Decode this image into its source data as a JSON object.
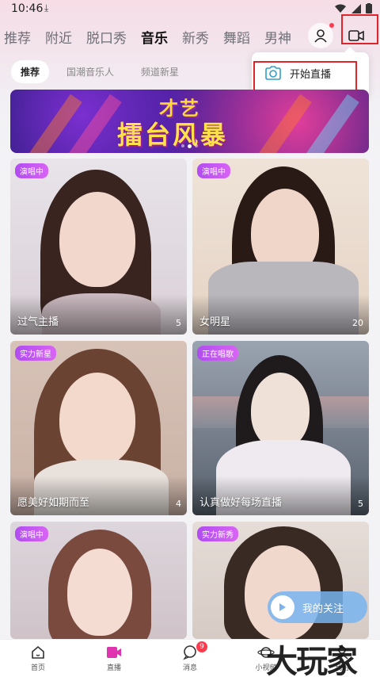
{
  "status_bar": {
    "time": "10:46"
  },
  "top_tabs": [
    "推荐",
    "附近",
    "脱口秀",
    "音乐",
    "新秀",
    "舞蹈",
    "男神"
  ],
  "active_tab_index": 3,
  "sub_tabs": [
    "推荐",
    "国潮音乐人",
    "频道新星"
  ],
  "popup": {
    "start_live_label": "开始直播"
  },
  "banner": {
    "line1": "才艺",
    "line2": "擂台风暴"
  },
  "cards": [
    {
      "badge": "演唱中",
      "title": "过气主播",
      "count": "5"
    },
    {
      "badge": "演唱中",
      "title": "女明星",
      "count": "20"
    },
    {
      "badge": "实力新星",
      "title": "愿美好如期而至",
      "count": "4"
    },
    {
      "badge": "正在唱歌",
      "title": "认真做好每场直播",
      "count": "5"
    },
    {
      "badge": "演唱中",
      "title": "",
      "count": ""
    },
    {
      "badge": "实力新秀",
      "title": "",
      "count": ""
    }
  ],
  "follow_button": {
    "label": "我的关注"
  },
  "bottom_nav": [
    {
      "label": "首页",
      "icon": "home-icon"
    },
    {
      "label": "直播",
      "icon": "live-camera-icon"
    },
    {
      "label": "消息",
      "icon": "message-icon",
      "badge": "9"
    },
    {
      "label": "小视频",
      "icon": "planet-icon"
    },
    {
      "label": "我的",
      "icon": "profile-icon"
    }
  ],
  "watermark": "大玩家",
  "colors": {
    "accent": "#ff3b4f",
    "badge": "#c257f2",
    "highlight": "#e0242b",
    "popup_icon": "#2fa0c8"
  }
}
